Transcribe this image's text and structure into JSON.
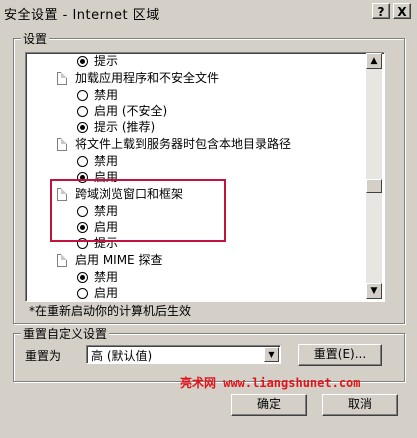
{
  "window": {
    "title": "安全设置 - Internet 区域",
    "help_label": "?",
    "close_label": "X"
  },
  "settings_group": {
    "label": "设置",
    "items": [
      {
        "kind": "option",
        "label": "提示",
        "checked": true
      },
      {
        "kind": "heading",
        "label": "加载应用程序和不安全文件"
      },
      {
        "kind": "option",
        "label": "禁用",
        "checked": false
      },
      {
        "kind": "option",
        "label": "启用 (不安全)",
        "checked": false
      },
      {
        "kind": "option",
        "label": "提示 (推荐)",
        "checked": true
      },
      {
        "kind": "heading",
        "label": "将文件上载到服务器时包含本地目录路径"
      },
      {
        "kind": "option",
        "label": "禁用",
        "checked": false
      },
      {
        "kind": "option",
        "label": "启用",
        "checked": true
      },
      {
        "kind": "heading",
        "label": "跨域浏览窗口和框架"
      },
      {
        "kind": "option",
        "label": "禁用",
        "checked": false
      },
      {
        "kind": "option",
        "label": "启用",
        "checked": true
      },
      {
        "kind": "option",
        "label": "提示",
        "checked": false
      },
      {
        "kind": "heading",
        "label": "启用 MIME 探查"
      },
      {
        "kind": "option",
        "label": "禁用",
        "checked": true
      },
      {
        "kind": "option",
        "label": "启用",
        "checked": false
      }
    ],
    "note": "*在重新启动你的计算机后生效"
  },
  "reset_group": {
    "label": "重置自定义设置",
    "reset_to_label": "重置为",
    "selected_value": "高 (默认值)",
    "reset_button": "重置(E)..."
  },
  "watermark": "亮术网 www.liangshunet.com",
  "buttons": {
    "ok": "确定",
    "cancel": "取消"
  },
  "colors": {
    "highlight_box": "#c0143c",
    "watermark": "#e0151b"
  }
}
